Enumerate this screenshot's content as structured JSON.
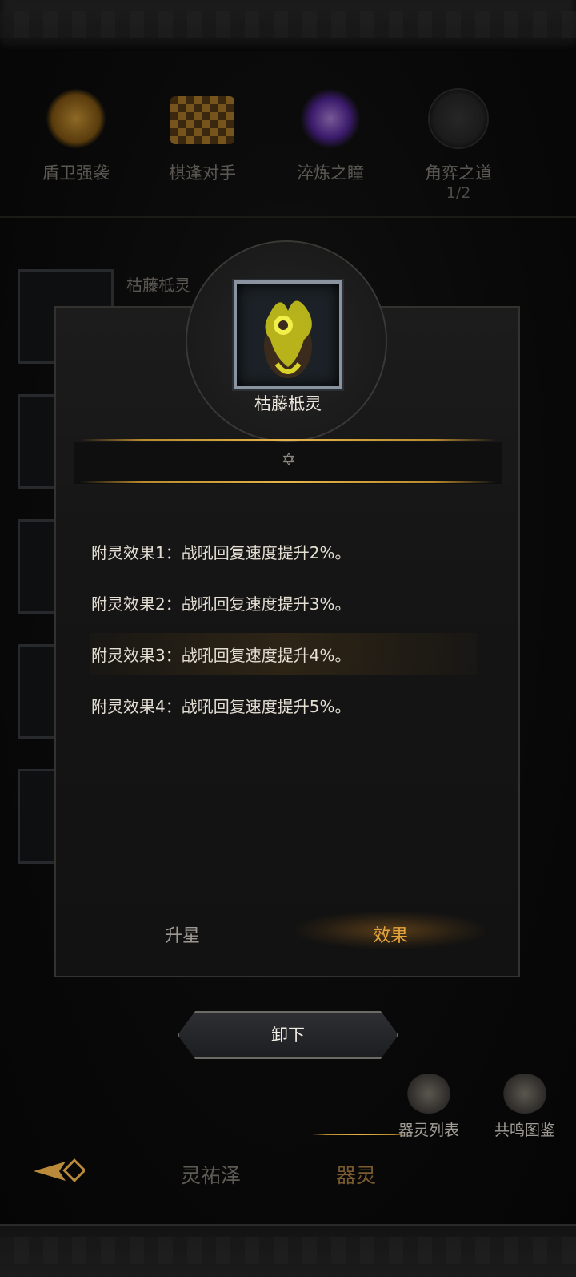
{
  "categories": [
    {
      "label": "盾卫强袭",
      "sub": "",
      "icon": "shield-wings-icon",
      "color": "#c88f23"
    },
    {
      "label": "棋逢对手",
      "sub": "",
      "icon": "chess-board-icon",
      "color": "#b4822e"
    },
    {
      "label": "淬炼之瞳",
      "sub": "",
      "icon": "purple-eye-icon",
      "color": "#6b3db5"
    },
    {
      "label": "角弈之道",
      "sub": "1/2",
      "icon": "dice-icon",
      "color": "#5a5a5a"
    }
  ],
  "background_list": {
    "first_item_name": "枯藤柢灵"
  },
  "modal": {
    "item_name": "枯藤柢灵",
    "effects": [
      "附灵效果1：战吼回复速度提升2%。",
      "附灵效果2：战吼回复速度提升3%。",
      "附灵效果3：战吼回复速度提升4%。",
      "附灵效果4：战吼回复速度提升5%。"
    ],
    "highlighted_effect_index": 2,
    "tabs": {
      "star_up": "升星",
      "effect": "效果"
    },
    "active_tab": "效果"
  },
  "unload_button": "卸下",
  "side_buttons": {
    "spirit_list": "器灵列表",
    "resonance_atlas": "共鸣图鉴"
  },
  "bottom_tabs": {
    "tab1": "灵祐泽",
    "tab2": "器灵"
  },
  "active_bottom_tab": "器灵",
  "colors": {
    "gold": "#e8b54a",
    "active_tab_text": "#e6a53c",
    "inactive_text": "#8c8880"
  }
}
